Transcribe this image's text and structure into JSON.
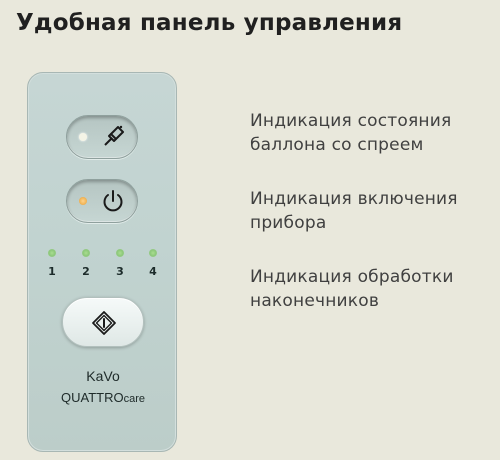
{
  "heading": "Удобная панель управления",
  "panel": {
    "buttons": [
      {
        "icon": "spray-can-icon",
        "indicator_color": "#f4f4e6"
      },
      {
        "icon": "power-icon",
        "indicator_color": "#f0b457"
      }
    ],
    "leds": [
      "1",
      "2",
      "3",
      "4"
    ],
    "led_color": "#9bd283",
    "start_icon": "diamond-start-icon",
    "brand_line1": "KaVo",
    "brand_line2_a": "QUATTRO",
    "brand_line2_b": "care"
  },
  "labels": {
    "spray": [
      "Индикация состояния",
      "баллона со спреем"
    ],
    "power": [
      "Индикация включения",
      "прибора"
    ],
    "treatment": [
      "Индикация обработки",
      "наконечников"
    ]
  }
}
